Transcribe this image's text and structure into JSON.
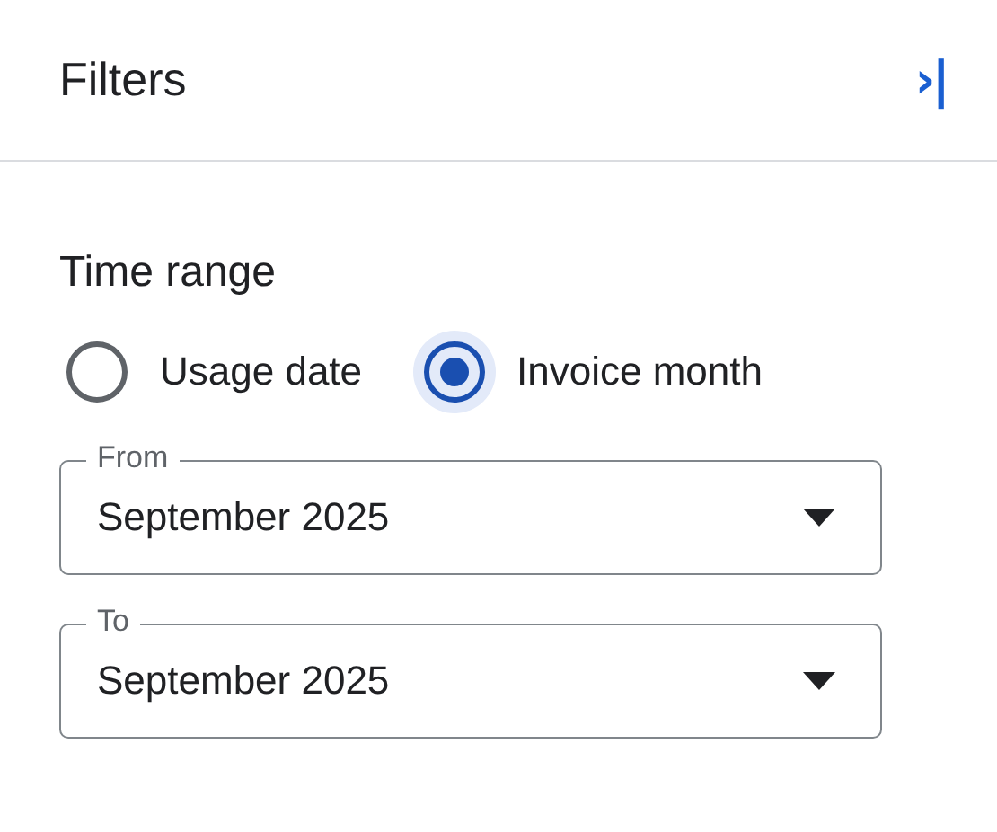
{
  "header": {
    "title": "Filters",
    "collapse_icon": "›|"
  },
  "section": {
    "title": "Time range",
    "radios": [
      {
        "label": "Usage date",
        "selected": false
      },
      {
        "label": "Invoice month",
        "selected": true
      }
    ],
    "fields": [
      {
        "label": "From",
        "value": "September 2025"
      },
      {
        "label": "To",
        "value": "September 2025"
      }
    ]
  }
}
